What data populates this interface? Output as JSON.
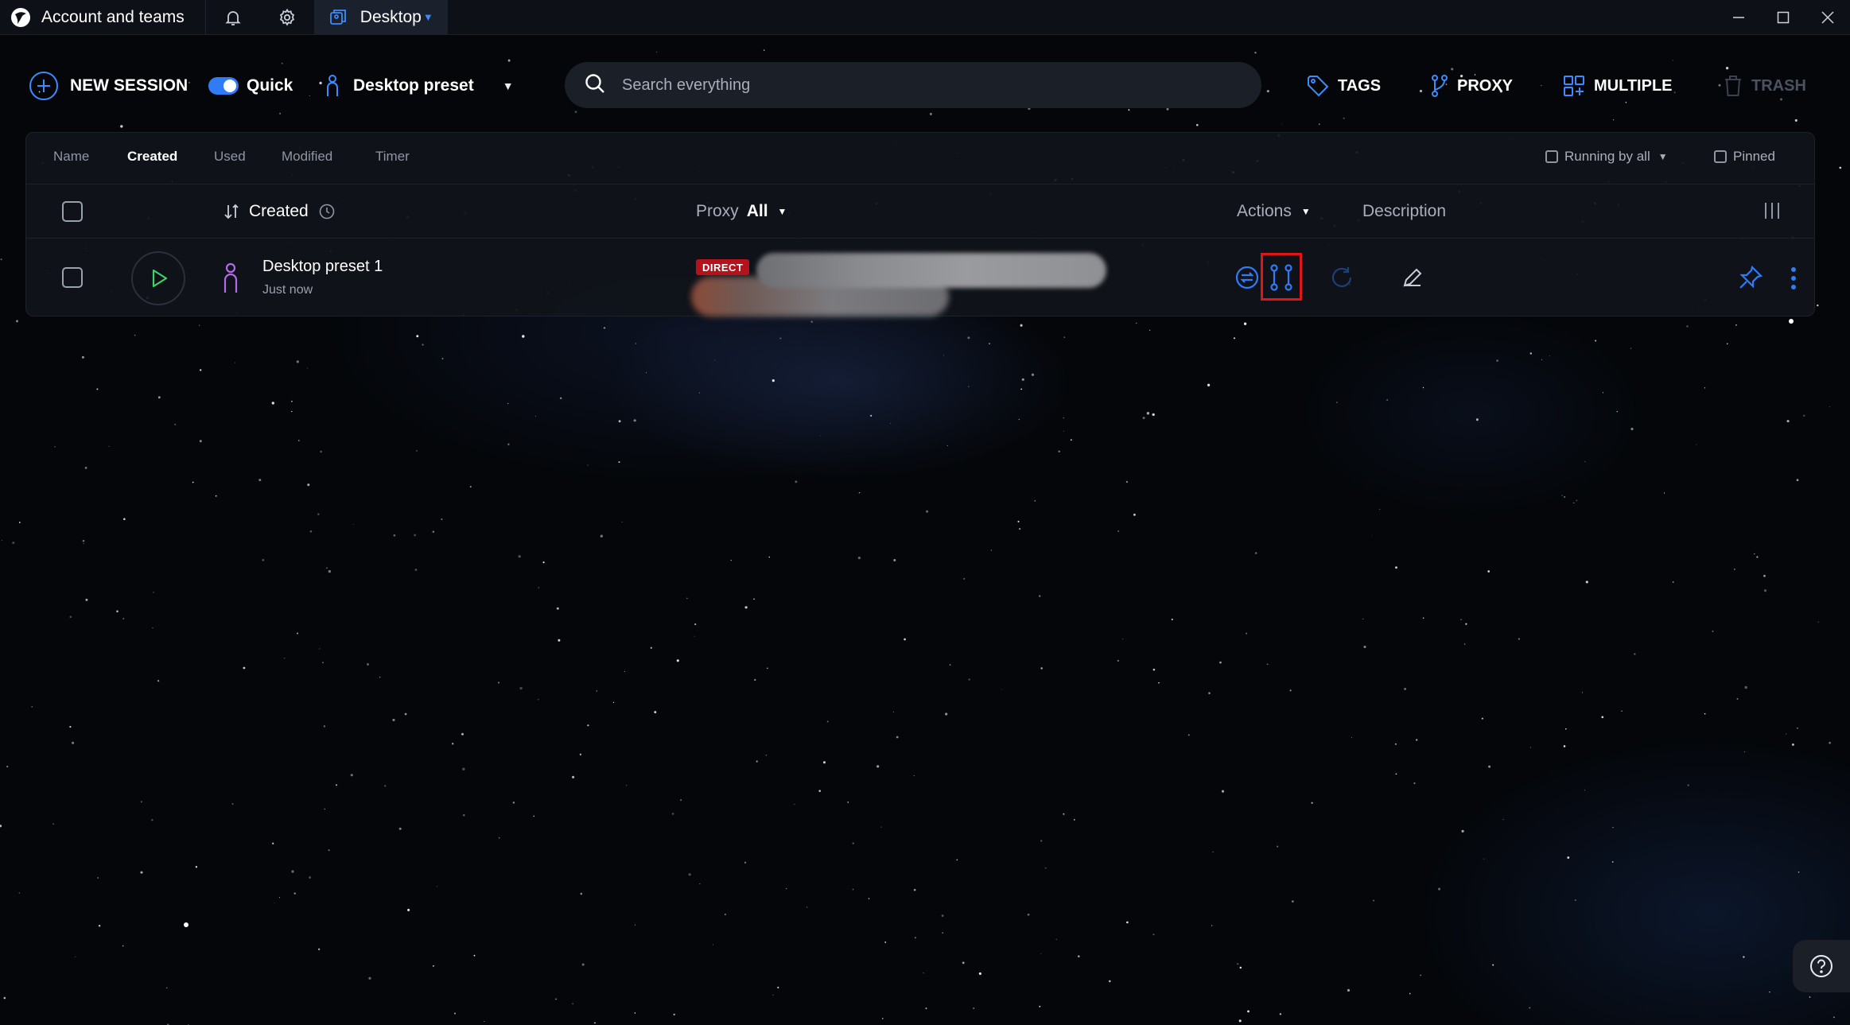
{
  "titlebar": {
    "title": "Account and teams",
    "tab_label": "Desktop"
  },
  "toolbar": {
    "new_session_label": "NEW SESSION",
    "quick_label": "Quick",
    "quick_enabled": true,
    "preset_label": "Desktop preset",
    "search_placeholder": "Search everything",
    "tags_label": "TAGS",
    "proxy_label": "PROXY",
    "multiple_label": "MULTIPLE",
    "trash_label": "TRASH"
  },
  "sort_tabs": [
    "Name",
    "Created",
    "Used",
    "Modified",
    "Timer"
  ],
  "active_sort_tab": "Created",
  "filters": {
    "running_label": "Running by all",
    "pinned_label": "Pinned"
  },
  "table": {
    "headers": {
      "created": "Created",
      "proxy": "Proxy",
      "proxy_filter": "All",
      "actions": "Actions",
      "description": "Description"
    },
    "rows": [
      {
        "name": "Desktop preset 1",
        "created": "Just now",
        "proxy_badge": "DIRECT"
      }
    ]
  },
  "colors": {
    "accent": "#2f7cf6",
    "direct_badge": "#b5121b",
    "highlight": "#e01616",
    "background": "#040609"
  }
}
